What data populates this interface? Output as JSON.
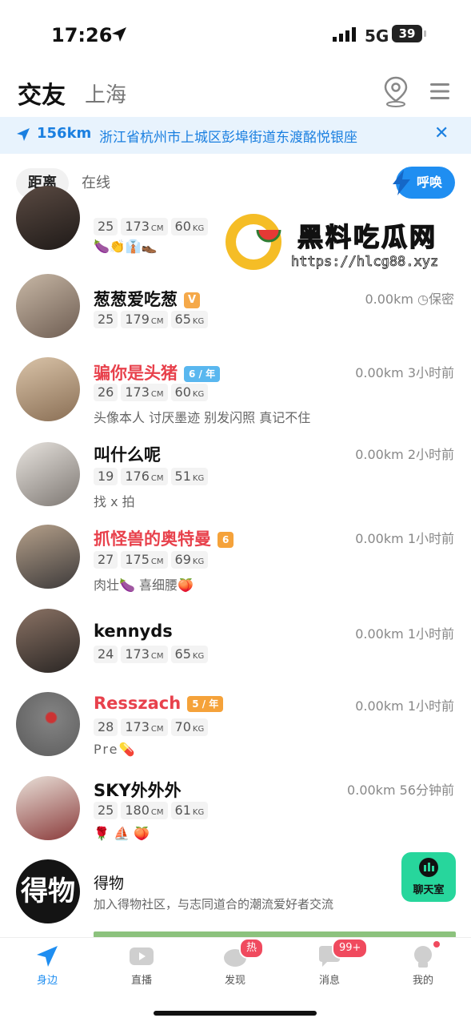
{
  "status_bar": {
    "time": "17:26",
    "network": "5G",
    "battery": "39"
  },
  "header": {
    "title": "交友",
    "city": "上海"
  },
  "banner": {
    "distance": "156km",
    "address": "浙江省杭州市上城区彭埠街道东渡酩悦银座",
    "close": "✕"
  },
  "filters": {
    "tab_active": "距离",
    "tab_other": "在线",
    "call_label": "呼唤"
  },
  "watermark": {
    "title": "黑料吃瓜网",
    "url": "https://hlcg88.xyz"
  },
  "users": [
    {
      "name": "",
      "age": "25",
      "height": "173",
      "weight": "60",
      "bio": "🍆👏👔👞",
      "distance": "",
      "time": "",
      "badge": ""
    },
    {
      "name": "葱葱爱吃葱",
      "age": "25",
      "height": "179",
      "weight": "65",
      "bio": "",
      "distance": "0.00km",
      "time": "保密",
      "badge": "V"
    },
    {
      "name": "骗你是头猪",
      "age": "26",
      "height": "173",
      "weight": "60",
      "bio": "头像本人 讨厌墨迹 别发闪照 真记不住",
      "distance": "0.00km",
      "time": "3小时前",
      "badge": "6 / 年"
    },
    {
      "name": "叫什么呢",
      "age": "19",
      "height": "176",
      "weight": "51",
      "bio": "找 x 拍",
      "distance": "0.00km",
      "time": "2小时前",
      "badge": ""
    },
    {
      "name": "抓怪兽的奥特曼",
      "age": "27",
      "height": "175",
      "weight": "69",
      "bio": "肉壮🍆 喜细腰🍑",
      "distance": "0.00km",
      "time": "1小时前",
      "badge": "6"
    },
    {
      "name": "kennyds",
      "age": "24",
      "height": "173",
      "weight": "65",
      "bio": "",
      "distance": "0.00km",
      "time": "1小时前",
      "badge": ""
    },
    {
      "name": "Resszach",
      "age": "28",
      "height": "173",
      "weight": "70",
      "bio": "Pre💊",
      "distance": "0.00km",
      "time": "1小时前",
      "badge": "5 / 年"
    },
    {
      "name": "SKY外外外",
      "age": "25",
      "height": "180",
      "weight": "61",
      "bio": "🌹 ⛵ 🍑",
      "distance": "0.00km",
      "time": "56分钟前",
      "badge": ""
    }
  ],
  "units": {
    "height": "CM",
    "weight": "KG"
  },
  "ad": {
    "logo": "得物",
    "name": "得物",
    "desc": "加入得物社区，与志同道合的潮流爱好者交流"
  },
  "chatroom": {
    "label": "聊天室"
  },
  "tabbar": {
    "tabs": [
      {
        "label": "身边"
      },
      {
        "label": "直播"
      },
      {
        "label": "发现",
        "badge": "热门"
      },
      {
        "label": "消息",
        "badge": "99+"
      },
      {
        "label": "我的"
      }
    ]
  },
  "colors": {
    "accent": "#1f8ef1",
    "vip_name": "#e8414c",
    "chatroom": "#27d69c"
  }
}
